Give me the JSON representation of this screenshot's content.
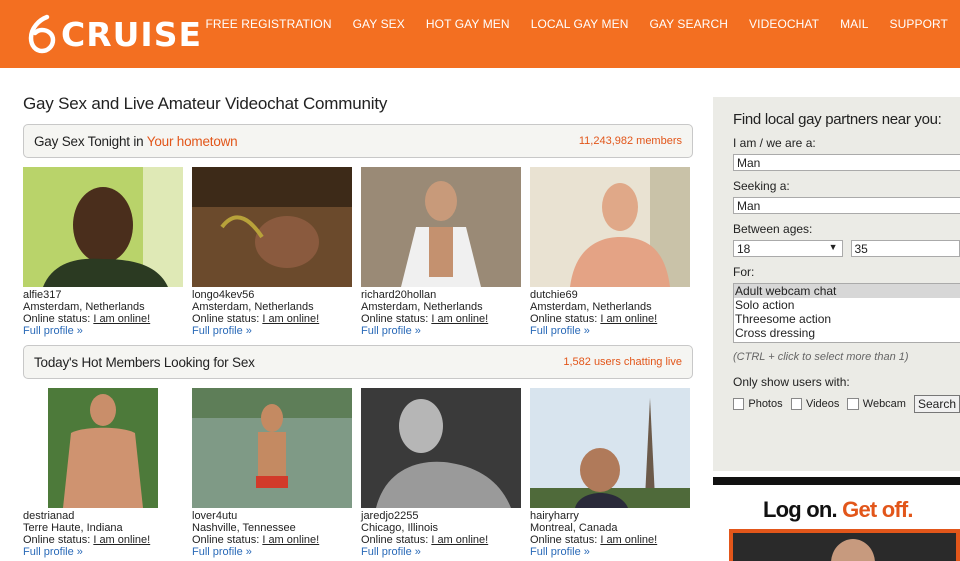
{
  "logo": {
    "text": "CRUISE"
  },
  "nav": [
    "FREE REGISTRATION",
    "GAY SEX",
    "HOT GAY MEN",
    "LOCAL GAY MEN",
    "GAY SEARCH",
    "VIDEOCHAT",
    "MAIL",
    "SUPPORT"
  ],
  "page_title": "Gay Sex and Live Amateur Videochat Community",
  "section1": {
    "title": "Gay Sex Tonight in ",
    "highlight": "Your hometown",
    "count": "11,243,982 members"
  },
  "section2": {
    "title": "Today's Hot Members Looking for Sex",
    "count": "1,582 users chatting live"
  },
  "status_label": "Online status: ",
  "status_value": "I am online!",
  "profile_link": "Full profile »",
  "members_row1": [
    {
      "name": "alfie317",
      "location": "Amsterdam, Netherlands"
    },
    {
      "name": "longo4kev56",
      "location": "Amsterdam, Netherlands"
    },
    {
      "name": "richard20hollan",
      "location": "Amsterdam, Netherlands"
    },
    {
      "name": "dutchie69",
      "location": "Amsterdam, Netherlands"
    }
  ],
  "members_row2": [
    {
      "name": "destrianad",
      "location": "Terre Haute, Indiana"
    },
    {
      "name": "lover4utu",
      "location": "Nashville, Tennessee"
    },
    {
      "name": "jaredjo2255",
      "location": "Chicago, Illinois"
    },
    {
      "name": "hairyharry",
      "location": "Montreal, Canada"
    }
  ],
  "search": {
    "heading": "Find local gay partners near you:",
    "iam_label": "I am / we are a:",
    "iam_value": "Man",
    "seeking_label": "Seeking a:",
    "seeking_value": "Man",
    "ages_label": "Between ages:",
    "age_min": "18",
    "age_max": "35",
    "for_label": "For:",
    "for_options": [
      "Adult webcam chat",
      "Solo action",
      "Threesome action",
      "Cross dressing"
    ],
    "hint": "(CTRL + click to select more than 1)",
    "only_label": "Only show users with:",
    "photos": "Photos",
    "videos": "Videos",
    "webcam": "Webcam",
    "button": "Search"
  },
  "ad": {
    "part1": "Log on. ",
    "part2": "Get off."
  },
  "colors": {
    "brand": "#f36f21",
    "accent": "#e2561a",
    "link": "#2a6ab8"
  }
}
